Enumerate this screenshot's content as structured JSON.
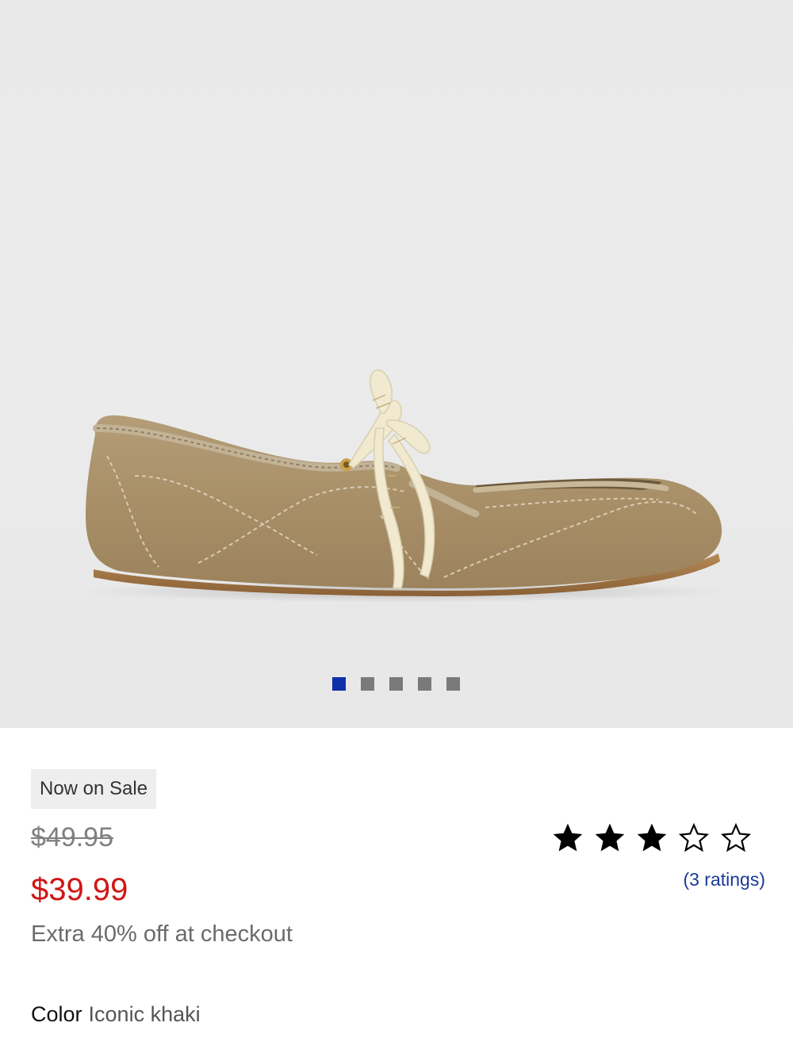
{
  "product": {
    "image_icon": "shoe-product-image",
    "carousel": {
      "total": 5,
      "active_index": 0,
      "active_color": "#0d2fa8",
      "inactive_color": "#7a7a7a"
    }
  },
  "pricing": {
    "badge": "Now on Sale",
    "original_price": "$49.95",
    "sale_price": "$39.99",
    "sale_color": "#d01616",
    "promo": "Extra 40% off at checkout"
  },
  "rating": {
    "stars": 3,
    "max_stars": 5,
    "ratings_text": "(3 ratings)",
    "link_color": "#1a3a9a"
  },
  "color": {
    "label": "Color",
    "value": "Iconic khaki"
  }
}
